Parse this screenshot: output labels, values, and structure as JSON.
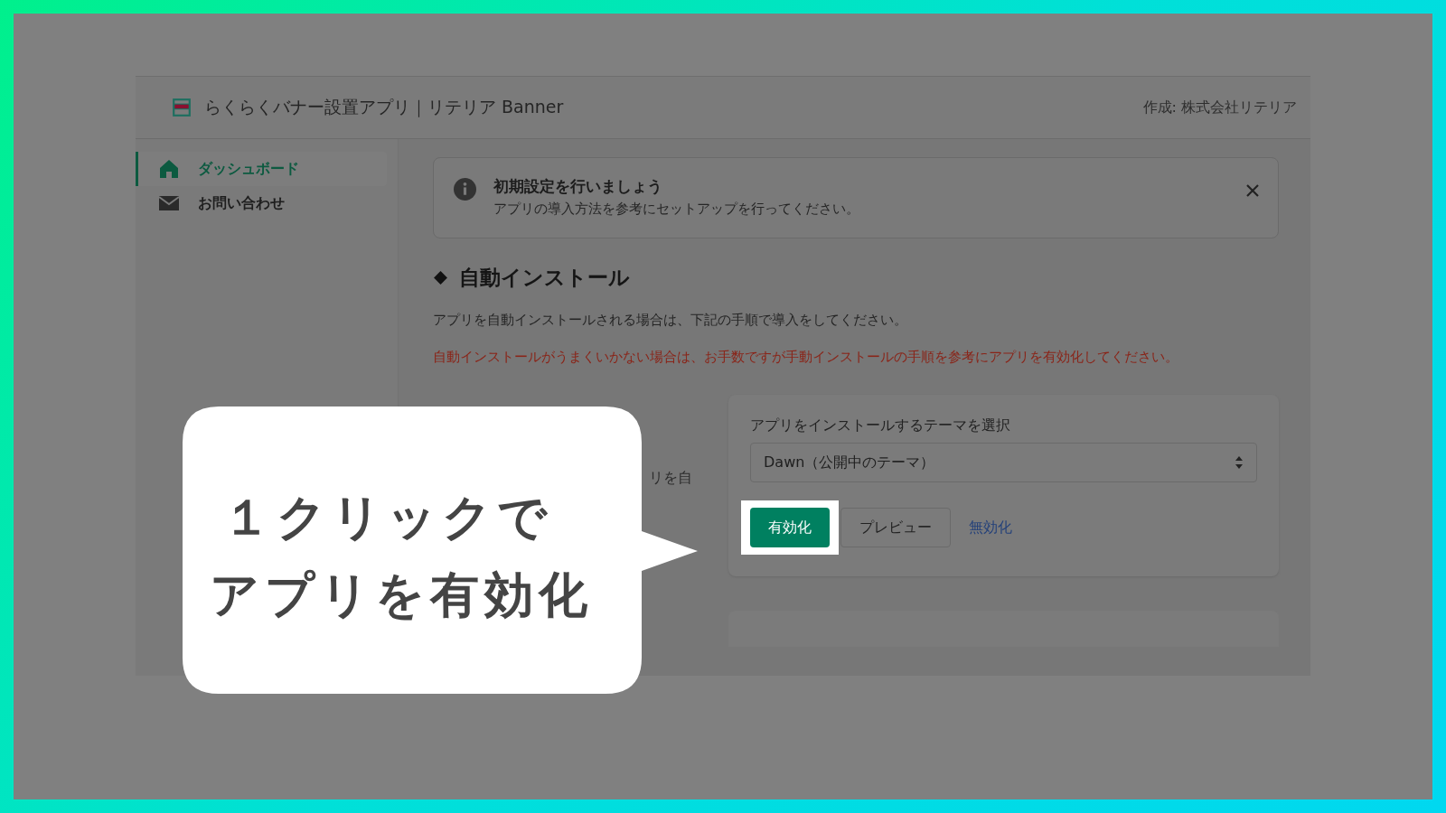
{
  "header": {
    "title": "らくらくバナー設置アプリ｜リテリア Banner",
    "author": "作成: 株式会社リテリア"
  },
  "sidebar": {
    "items": [
      {
        "label": "ダッシュボード",
        "kind": "home",
        "selected": true
      },
      {
        "label": "お問い合わせ",
        "kind": "mail",
        "selected": false
      }
    ]
  },
  "notice": {
    "title": "初期設定を行いましょう",
    "text": "アプリの導入方法を参考にセットアップを行ってください。"
  },
  "section": {
    "title": "自動インストール",
    "intro": "アプリを自動インストールされる場合は、下記の手順で導入をしてください。",
    "warning": "自動インストールがうまくいかない場合は、お手数ですが手動インストールの手順を参考にアプリを有効化してください。"
  },
  "install": {
    "column_1": "リを自",
    "select_label": "アプリをインストールするテーマを選択",
    "select_value": "Dawn（公開中のテーマ）",
    "buttons": [
      {
        "label": "有効化",
        "kind": "primary",
        "highlighted": true
      },
      {
        "label": "プレビュー",
        "kind": "secondary",
        "highlighted": false
      },
      {
        "label": "無効化",
        "kind": "link",
        "highlighted": false
      }
    ]
  },
  "callout": {
    "lines": [
      "１クリックで",
      "アプリを有効化"
    ]
  }
}
